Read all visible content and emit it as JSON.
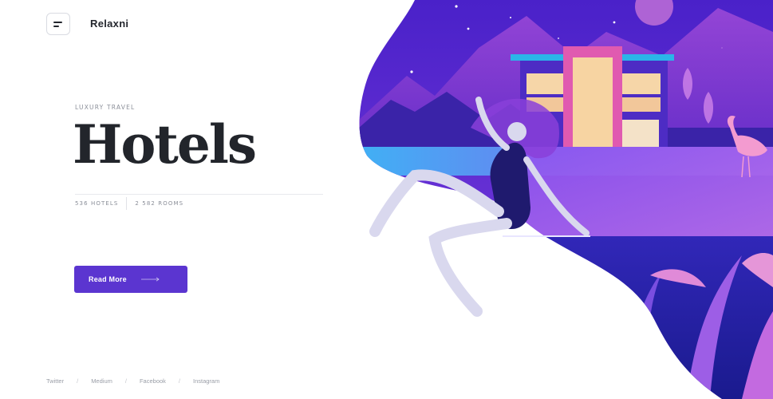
{
  "header": {
    "brand": "Relaxni",
    "menu_icon": "menu-icon"
  },
  "hero": {
    "eyebrow": "LUXURY TRAVEL",
    "title": "Hotels",
    "stats": [
      {
        "label": "536 HOTELS"
      },
      {
        "label": "2 582 ROOMS"
      }
    ],
    "cta": {
      "label": "Read More",
      "icon": "arrow-right-icon"
    }
  },
  "footer": {
    "links": [
      "Twitter",
      "Medium",
      "Facebook",
      "Instagram"
    ],
    "separator": "/"
  },
  "colors": {
    "accent": "#5b35d0",
    "text_dark": "#23262d",
    "text_muted": "#8b8f99"
  }
}
